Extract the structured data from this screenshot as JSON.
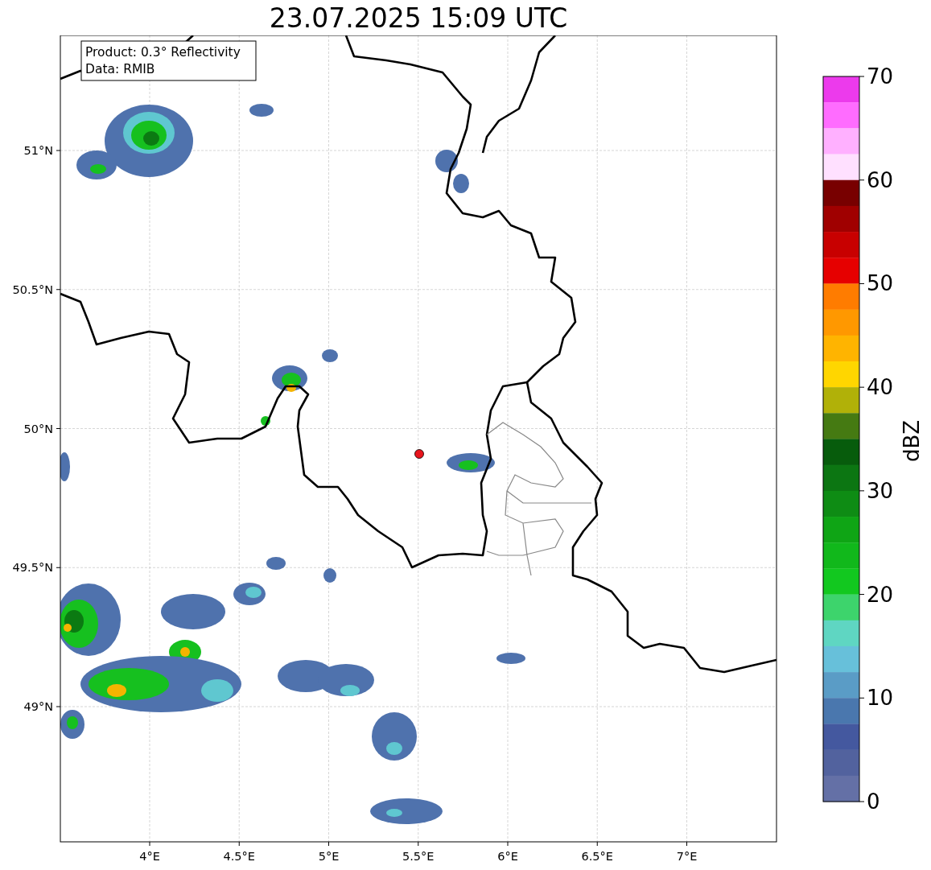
{
  "title": "23.07.2025 15:09 UTC",
  "info_box": [
    "Product: 0.3° Reflectivity",
    "Data: RMIB"
  ],
  "x_ticks": [
    "4°E",
    "4.5°E",
    "5°E",
    "5.5°E",
    "6°E",
    "6.5°E",
    "7°E"
  ],
  "y_ticks": [
    "51°N",
    "50.5°N",
    "50°N",
    "49.5°N",
    "49°N"
  ],
  "colorbar": {
    "label": "dBZ",
    "ticks": [
      "70",
      "60",
      "50",
      "40",
      "30",
      "20",
      "10",
      "0"
    ],
    "bins": [
      {
        "color": "#ec3aec"
      },
      {
        "color": "#ff6cff"
      },
      {
        "color": "#ffb0ff"
      },
      {
        "color": "#ffe0ff"
      },
      {
        "color": "#780000"
      },
      {
        "color": "#a00000"
      },
      {
        "color": "#c80000"
      },
      {
        "color": "#e60000"
      },
      {
        "color": "#ff7c00"
      },
      {
        "color": "#ff9800"
      },
      {
        "color": "#ffb400"
      },
      {
        "color": "#ffd600"
      },
      {
        "color": "#b1b108"
      },
      {
        "color": "#457a12"
      },
      {
        "color": "#075c0c"
      },
      {
        "color": "#0c7612"
      },
      {
        "color": "#0e8c14"
      },
      {
        "color": "#0fa515"
      },
      {
        "color": "#11b81b"
      },
      {
        "color": "#12c81f"
      },
      {
        "color": "#3dd46c"
      },
      {
        "color": "#5fd6c2"
      },
      {
        "color": "#67c0da"
      },
      {
        "color": "#5a9cc6"
      },
      {
        "color": "#4a77ae"
      },
      {
        "color": "#44589f"
      },
      {
        "color": "#52629e"
      },
      {
        "color": "#6470a6"
      }
    ]
  }
}
